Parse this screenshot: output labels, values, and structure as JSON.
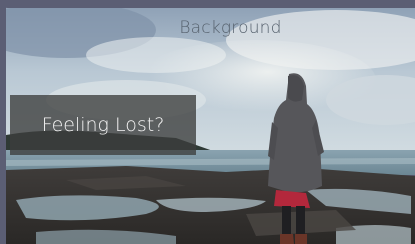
{
  "background_label": "Background",
  "overlay_caption": "Feeling Lost?",
  "colors": {
    "frame": "#5b5e74",
    "overlay": "#3c3e3c",
    "caption": "#f4f4f4",
    "label": "#55606c"
  }
}
